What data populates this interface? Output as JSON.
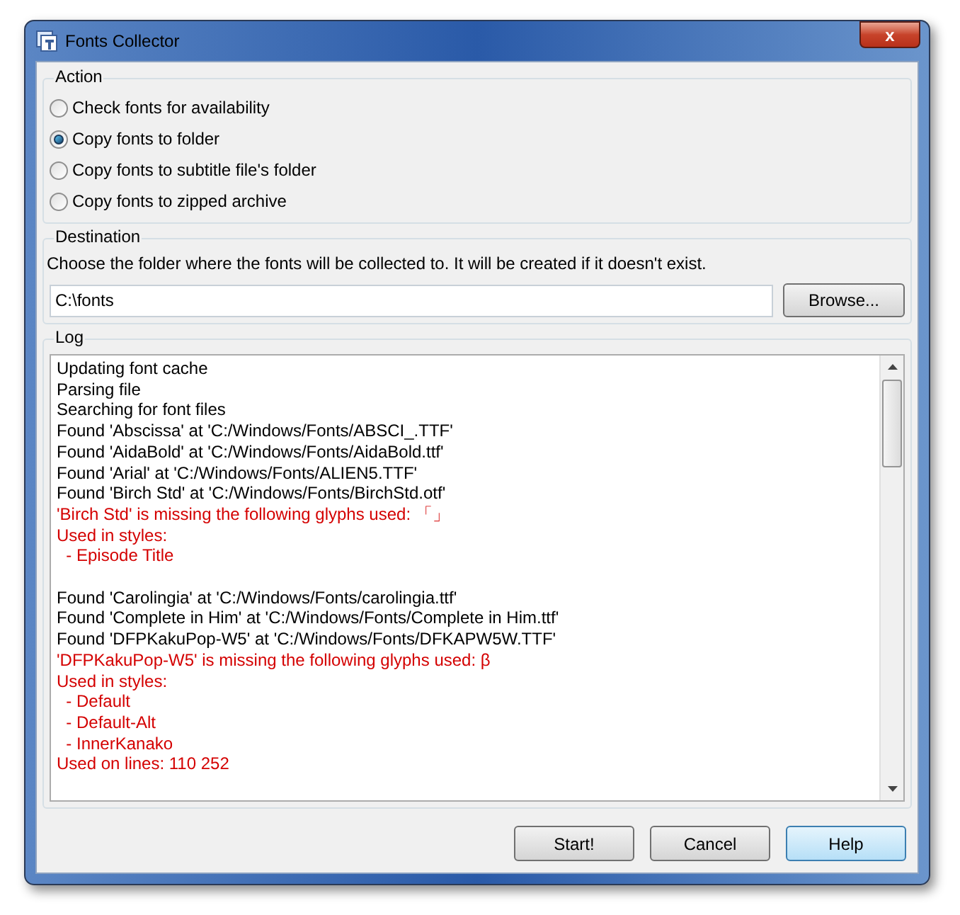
{
  "window": {
    "title": "Fonts Collector",
    "close_label": "x"
  },
  "action": {
    "title": "Action",
    "options": [
      {
        "label": "Check fonts for availability",
        "selected": false
      },
      {
        "label": "Copy fonts to folder",
        "selected": true
      },
      {
        "label": "Copy fonts to subtitle file's folder",
        "selected": false
      },
      {
        "label": "Copy fonts to zipped archive",
        "selected": false
      }
    ]
  },
  "destination": {
    "title": "Destination",
    "description": "Choose the folder where the fonts will be collected to. It will be created if it doesn't exist.",
    "path": "C:\\fonts",
    "browse_button": "Browse..."
  },
  "log": {
    "title": "Log",
    "lines": [
      {
        "text": "Updating font cache",
        "kind": "info"
      },
      {
        "text": "Parsing file",
        "kind": "info"
      },
      {
        "text": "Searching for font files",
        "kind": "info"
      },
      {
        "text": "Found 'Abscissa' at 'C:/Windows/Fonts/ABSCI_.TTF'",
        "kind": "info"
      },
      {
        "text": "Found 'AidaBold' at 'C:/Windows/Fonts/AidaBold.ttf'",
        "kind": "info"
      },
      {
        "text": "Found 'Arial' at 'C:/Windows/Fonts/ALIEN5.TTF'",
        "kind": "info"
      },
      {
        "text": "Found 'Birch Std' at 'C:/Windows/Fonts/BirchStd.otf'",
        "kind": "info"
      },
      {
        "text": "'Birch Std' is missing the following glyphs used: 「」",
        "kind": "warning"
      },
      {
        "text": "Used in styles:",
        "kind": "warning"
      },
      {
        "text": "  - Episode Title",
        "kind": "warning"
      },
      {
        "text": "Found 'Carolingia' at 'C:/Windows/Fonts/carolingia.ttf'",
        "kind": "info",
        "gap_before": true
      },
      {
        "text": "Found 'Complete in Him' at 'C:/Windows/Fonts/Complete in Him.ttf'",
        "kind": "info"
      },
      {
        "text": "Found 'DFPKakuPop-W5' at 'C:/Windows/Fonts/DFKAPW5W.TTF'",
        "kind": "info"
      },
      {
        "text": "'DFPKakuPop-W5' is missing the following glyphs used: β",
        "kind": "warning"
      },
      {
        "text": "Used in styles:",
        "kind": "warning"
      },
      {
        "text": "  - Default",
        "kind": "warning"
      },
      {
        "text": "  - Default-Alt",
        "kind": "warning"
      },
      {
        "text": "  - InnerKanako",
        "kind": "warning"
      },
      {
        "text": "Used on lines: 110 252",
        "kind": "warning"
      }
    ]
  },
  "buttons": [
    {
      "label": "Start!",
      "focused": false
    },
    {
      "label": "Cancel",
      "focused": false
    },
    {
      "label": "Help",
      "focused": true
    }
  ]
}
